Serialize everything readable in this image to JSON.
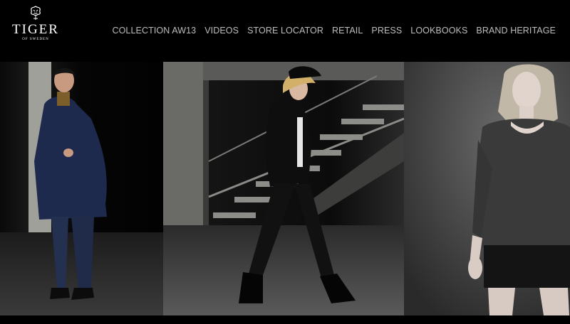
{
  "brand": {
    "name": "TIGER",
    "tagline": "OF SWEDEN"
  },
  "nav": {
    "items": [
      "COLLECTION AW13",
      "VIDEOS",
      "STORE LOCATOR",
      "RETAIL",
      "PRESS",
      "LOOKBOOKS",
      "BRAND HERITAGE"
    ]
  },
  "colors": {
    "background": "#000000",
    "nav_text": "#bdbdbd",
    "logo": "#ffffff"
  }
}
